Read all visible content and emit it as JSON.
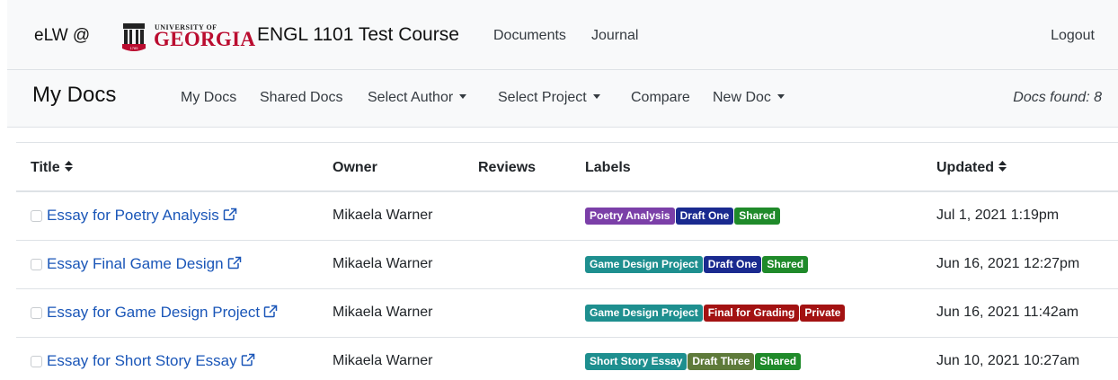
{
  "header": {
    "brand": "eLW @",
    "logo": {
      "top_text": "UNIVERSITY OF",
      "main_text": "GEORGIA",
      "seal_text": "1785"
    },
    "course_title": "ENGL 1101 Test Course",
    "nav": [
      "Documents",
      "Journal"
    ],
    "logout": "Logout"
  },
  "subnav": {
    "title": "My Docs",
    "items": [
      {
        "label": "My Docs",
        "dropdown": false
      },
      {
        "label": "Shared Docs",
        "dropdown": false
      },
      {
        "label": "Select Author",
        "dropdown": true
      },
      {
        "label": "Select Project",
        "dropdown": true
      },
      {
        "label": "Compare",
        "dropdown": false
      },
      {
        "label": "New Doc",
        "dropdown": true
      }
    ],
    "docs_found": "Docs found: 8"
  },
  "table": {
    "columns": [
      "Title",
      "Owner",
      "Reviews",
      "Labels",
      "Updated"
    ],
    "rows": [
      {
        "title": "Essay for Poetry Analysis",
        "owner": "Mikaela Warner",
        "reviews": "",
        "labels": [
          {
            "text": "Poetry Analysis",
            "color": "#7b3fa8"
          },
          {
            "text": "Draft One",
            "color": "#1a2a8f"
          },
          {
            "text": "Shared",
            "color": "#1f8a2a"
          }
        ],
        "updated": "Jul 1, 2021 1:19pm"
      },
      {
        "title": "Essay Final Game Design",
        "owner": "Mikaela Warner",
        "reviews": "",
        "labels": [
          {
            "text": "Game Design Project",
            "color": "#1e8f8f"
          },
          {
            "text": "Draft One",
            "color": "#1a2a8f"
          },
          {
            "text": "Shared",
            "color": "#1f8a2a"
          }
        ],
        "updated": "Jun 16, 2021 12:27pm"
      },
      {
        "title": "Essay for Game Design Project",
        "owner": "Mikaela Warner",
        "reviews": "",
        "labels": [
          {
            "text": "Game Design Project",
            "color": "#1e8f8f"
          },
          {
            "text": "Final for Grading",
            "color": "#a31212"
          },
          {
            "text": "Private",
            "color": "#a31212"
          }
        ],
        "updated": "Jun 16, 2021 11:42am"
      },
      {
        "title": "Essay for Short Story Essay",
        "owner": "Mikaela Warner",
        "reviews": "",
        "labels": [
          {
            "text": "Short Story Essay",
            "color": "#1e8f8f"
          },
          {
            "text": "Draft Three",
            "color": "#5e7a3a"
          },
          {
            "text": "Shared",
            "color": "#1f8a2a"
          }
        ],
        "updated": "Jun 10, 2021 10:27am"
      }
    ]
  },
  "colors": {
    "link": "#1a56b8",
    "uga_red": "#ba0c2f",
    "navbar_bg": "#f8f9fa"
  },
  "icons": {
    "sort": "sort-icon",
    "external_link": "external-link-icon",
    "dropdown": "caret-down-icon"
  }
}
